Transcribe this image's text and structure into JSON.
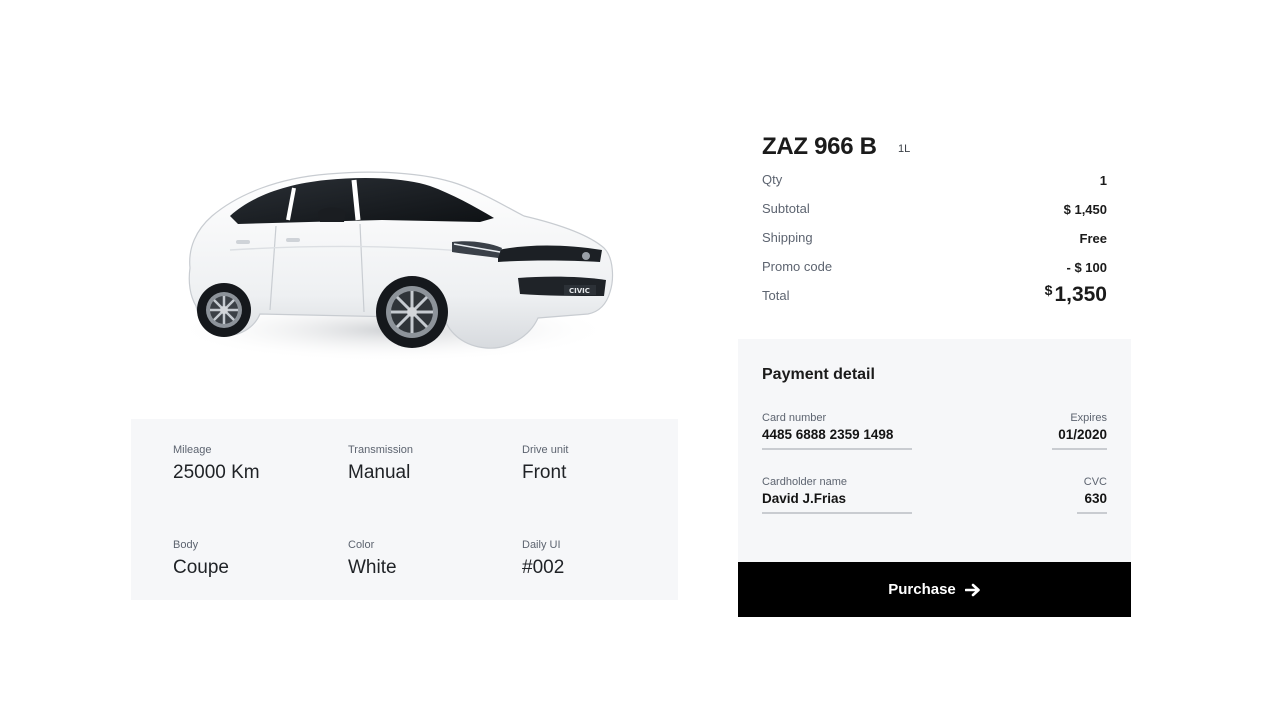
{
  "vehicle": {
    "image_alt": "White sedan car",
    "badge_text": "CIVIC"
  },
  "specs": [
    {
      "label": "Mileage",
      "value": "25000 Km"
    },
    {
      "label": "Transmission",
      "value": "Manual"
    },
    {
      "label": "Drive unit",
      "value": "Front"
    },
    {
      "label": "Body",
      "value": "Coupe"
    },
    {
      "label": "Color",
      "value": "White"
    },
    {
      "label": "Daily UI",
      "value": "#002"
    }
  ],
  "order": {
    "plate": "ZAZ 966 B",
    "plate_sub": "1L",
    "qty_label": "Qty",
    "qty_value": "1",
    "subtotal_label": "Subtotal",
    "subtotal_value": "$ 1,450",
    "shipping_label": "Shipping",
    "shipping_value": "Free",
    "promo_label": "Promo code",
    "promo_value": "- $ 100",
    "total_label": "Total",
    "total_currency": "$",
    "total_value": "1,350"
  },
  "payment": {
    "title": "Payment detail",
    "card_number_label": "Card number",
    "card_number_value": "4485 6888 2359 1498",
    "expires_label": "Expires",
    "expires_value": "01/2020",
    "cardholder_label": "Cardholder name",
    "cardholder_value": "David J.Frias",
    "cvc_label": "CVC",
    "cvc_value": "630"
  },
  "actions": {
    "purchase_label": "Purchase",
    "purchase_icon": "arrow-right-icon"
  },
  "colors": {
    "panel_bg": "#f6f7f9",
    "button_bg": "#000000",
    "button_text": "#ffffff",
    "muted_text": "#5d6470"
  }
}
